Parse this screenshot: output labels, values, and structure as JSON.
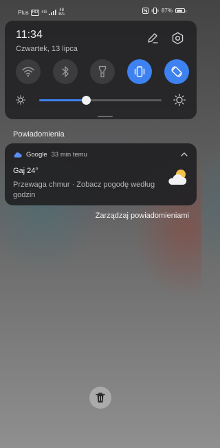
{
  "status_bar": {
    "carrier": "Plus",
    "network_badge": "HD",
    "signal_type": "4G",
    "net_speed_value": "48",
    "net_speed_unit": "B/s",
    "battery_percent": "87%",
    "battery_level": 0.87,
    "icons": [
      "nfc-icon",
      "vibrate-icon",
      "signal-icon",
      "battery-icon"
    ]
  },
  "quick_panel": {
    "time": "11:34",
    "date": "Czwartek, 13 lipca",
    "tiles": [
      {
        "name": "wifi",
        "icon": "wifi-icon",
        "active": false
      },
      {
        "name": "bluetooth",
        "icon": "bluetooth-icon",
        "active": false
      },
      {
        "name": "flashlight",
        "icon": "flashlight-icon",
        "active": false
      },
      {
        "name": "vibrate",
        "icon": "vibrate-icon",
        "active": true
      },
      {
        "name": "auto-rotate",
        "icon": "auto-rotate-icon",
        "active": true
      }
    ],
    "brightness_level": 0.38,
    "accent_color": "#3d82f0"
  },
  "notifications": {
    "section_title": "Powiadomienia",
    "items": [
      {
        "app": "Google",
        "time": "33 min temu",
        "title": "Gaj 24°",
        "body": "Przewaga chmur · Zobacz pogodę według godzin"
      }
    ],
    "manage_label": "Zarządzaj powiadomieniami"
  }
}
